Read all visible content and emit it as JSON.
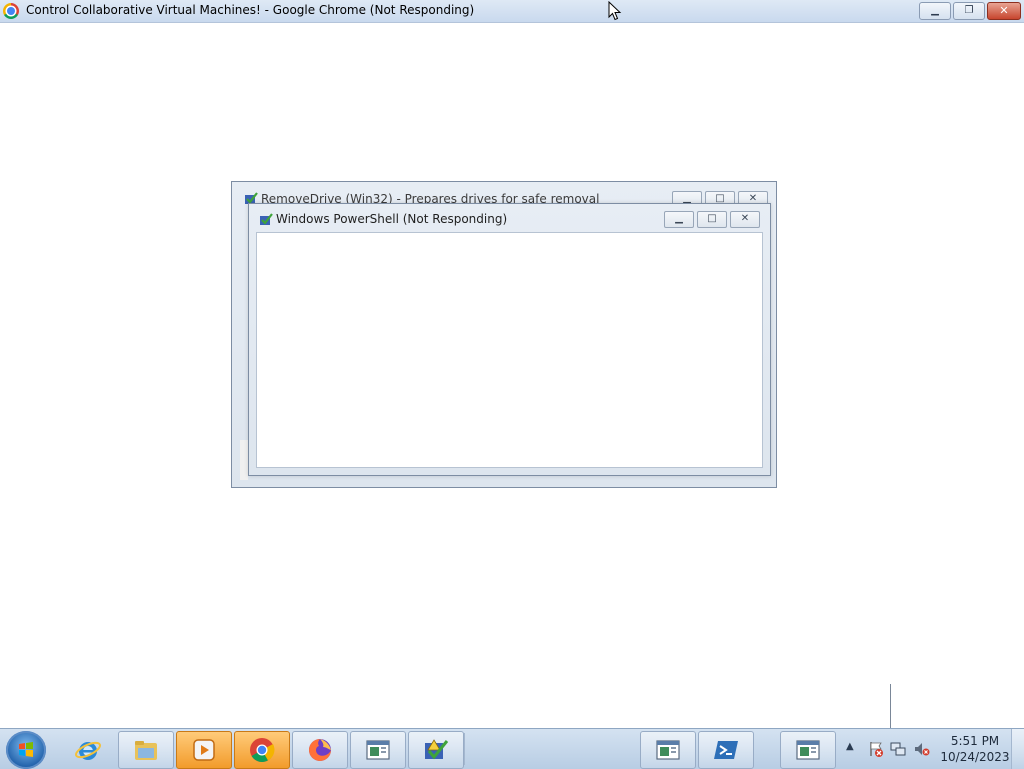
{
  "chrome_window": {
    "title": "Control Collaborative Virtual Machines! - Google Chrome (Not Responding)",
    "controls": {
      "minimize": "▁",
      "restore": "❐",
      "close": "✕"
    }
  },
  "windows": {
    "removedrive": {
      "title": "RemoveDrive (Win32) - Prepares drives for safe removal",
      "controls": {
        "minimize": "▁",
        "maximize": "□",
        "close": "✕"
      }
    },
    "powershell": {
      "title": "Windows PowerShell (Not Responding)",
      "controls": {
        "minimize": "▁",
        "maximize": "□",
        "close": "✕"
      }
    }
  },
  "taskbar": {
    "pinned": [
      {
        "name": "internet-explorer"
      },
      {
        "name": "file-explorer"
      },
      {
        "name": "media-player"
      },
      {
        "name": "chrome"
      },
      {
        "name": "firefox"
      },
      {
        "name": "console-window"
      },
      {
        "name": "removedrive-app"
      }
    ],
    "running": [
      {
        "name": "console-window-2"
      },
      {
        "name": "powershell"
      },
      {
        "name": "console-window-3"
      }
    ],
    "tray": {
      "arrow": "▲",
      "icons": [
        "action-center-warning-icon",
        "network-icon",
        "volume-muted-icon"
      ]
    },
    "clock": {
      "time": "5:51 PM",
      "date": "10/24/2023"
    }
  },
  "colors": {
    "taskbar_top": "#d4e2f1",
    "taskbar_bottom": "#b8cde4",
    "close_red": "#c7452e"
  }
}
